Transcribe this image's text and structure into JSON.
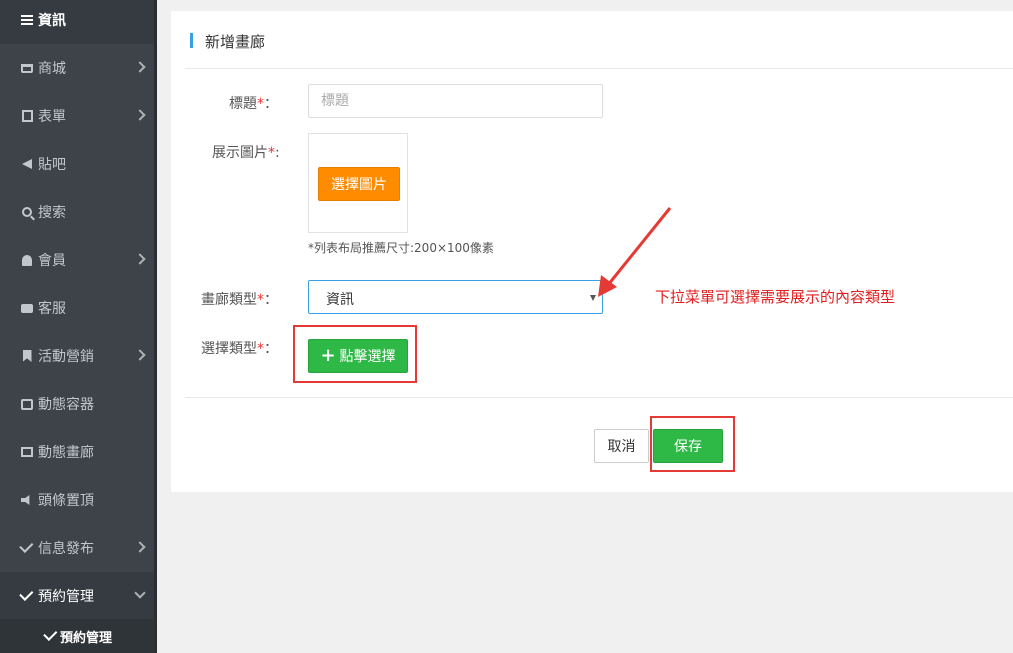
{
  "sidebar": {
    "items": [
      {
        "label": "資訊",
        "icon": "list-icon",
        "has_arrow": false
      },
      {
        "label": "商城",
        "icon": "cart-icon",
        "has_arrow": true
      },
      {
        "label": "表單",
        "icon": "document-icon",
        "has_arrow": true
      },
      {
        "label": "貼吧",
        "icon": "bullhorn-icon",
        "has_arrow": false
      },
      {
        "label": "搜索",
        "icon": "search-icon",
        "has_arrow": false
      },
      {
        "label": "會員",
        "icon": "bell-icon",
        "has_arrow": true
      },
      {
        "label": "客服",
        "icon": "chat-icon",
        "has_arrow": false
      },
      {
        "label": "活動營銷",
        "icon": "bookmark-icon",
        "has_arrow": true
      },
      {
        "label": "動態容器",
        "icon": "inbox-icon",
        "has_arrow": false
      },
      {
        "label": "動態畫廊",
        "icon": "image-icon",
        "has_arrow": false
      },
      {
        "label": "頭條置頂",
        "icon": "volume-icon",
        "has_arrow": false
      },
      {
        "label": "信息發布",
        "icon": "checkbox-icon",
        "has_arrow": true
      },
      {
        "label": "預約管理",
        "icon": "checkbox-icon",
        "has_arrow": true,
        "expanded": true
      }
    ],
    "sub_items": [
      {
        "label": "預約管理",
        "icon": "checkbox-icon"
      }
    ]
  },
  "form": {
    "header_title": "新增畫廊",
    "title_label": "標題",
    "title_placeholder": "標題",
    "image_label": "展示圖片",
    "choose_image_button": "選擇圖片",
    "image_hint": "*列表布局推薦尺寸:200×100像素",
    "type_label": "畫廊類型",
    "type_value": "資訊",
    "select_type_label": "選擇類型",
    "select_button": "點擊選擇",
    "required_mark": "*",
    "colon": "：",
    "cancel_button": "取消",
    "save_button": "保存"
  },
  "annotation": {
    "text": "下拉菜單可選擇需要展示的內容類型"
  },
  "colors": {
    "sidebar_bg": "#3d4348",
    "accent_blue": "#3aa0e5",
    "orange": "#ff8c00",
    "green": "#2eb845",
    "annotation_red": "#e53935"
  }
}
